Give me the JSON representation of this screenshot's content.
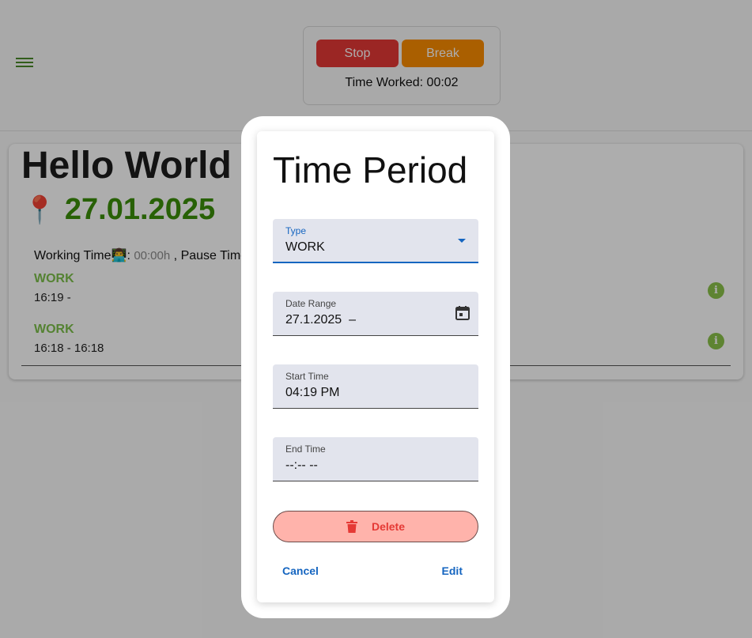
{
  "timer": {
    "stop_label": "Stop",
    "break_label": "Break",
    "time_worked": "Time Worked: 00:02"
  },
  "card": {
    "greeting": "Hello World",
    "pin_glyph": "📍",
    "date": "27.01.2025",
    "working_time_label": "Working Time",
    "working_time_emoji": "👨‍💻",
    "working_time_value": "00:00h",
    "pause_label": ", Pause Time",
    "entries": [
      {
        "type": "WORK",
        "time": "16:19 -"
      },
      {
        "type": "WORK",
        "time": "16:18 - 16:18"
      }
    ]
  },
  "dialog": {
    "title": "Time Period",
    "type_label": "Type",
    "type_value": "WORK",
    "date_range_label": "Date Range",
    "date_range_value": "27.1.2025  –",
    "start_time_label": "Start Time",
    "start_time_value": "04:19 PM",
    "end_time_label": "End Time",
    "end_time_value": "--:-- --",
    "delete_label": "Delete",
    "cancel_label": "Cancel",
    "edit_label": "Edit"
  },
  "colors": {
    "accent_blue": "#1565c0",
    "green": "#3c8f0a",
    "stop_red": "#e53935",
    "break_orange": "#fb8c00"
  }
}
